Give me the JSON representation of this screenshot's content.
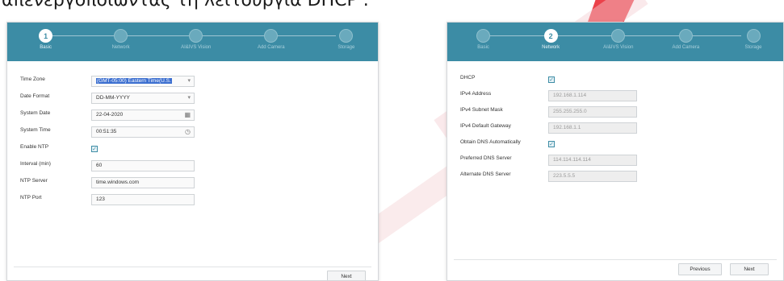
{
  "caption": "απενεργοποιώντας τη λειτουργία DHCP .",
  "steps": [
    "Basic",
    "Network",
    "AI&IVS Vision",
    "Add Camera",
    "Storage"
  ],
  "basic": {
    "current_step": "1",
    "rows": {
      "time_zone": {
        "label": "Time Zone",
        "value": "(GMT-05:00) Eastern Time(U.S. "
      },
      "date_format": {
        "label": "Date Format",
        "value": "DD-MM-YYYY"
      },
      "system_date": {
        "label": "System Date",
        "value": "22-04-2020"
      },
      "system_time": {
        "label": "System Time",
        "value": "00:51:35"
      },
      "enable_ntp": {
        "label": "Enable NTP",
        "checked": true
      },
      "interval": {
        "label": "Interval (min)",
        "value": "60"
      },
      "ntp_server": {
        "label": "NTP Server",
        "value": "time.windows.com"
      },
      "ntp_port": {
        "label": "NTP Port",
        "value": "123"
      }
    },
    "next_label": "Next"
  },
  "network": {
    "current_step": "2",
    "rows": {
      "dhcp": {
        "label": "DHCP",
        "checked": true
      },
      "ipv4_address": {
        "label": "IPv4 Address",
        "value": "192.168.1.114"
      },
      "ipv4_subnet": {
        "label": "IPv4 Subnet Mask",
        "value": "255.255.255.0"
      },
      "ipv4_gateway": {
        "label": "IPv4 Default Gateway",
        "value": "192.168.1.1"
      },
      "obtain_dns": {
        "label": "Obtain DNS Automatically",
        "checked": true
      },
      "preferred_dns": {
        "label": "Preferred DNS Server",
        "value": "114.114.114.114"
      },
      "alternate_dns": {
        "label": "Alternate DNS Server",
        "value": "223.5.5.5"
      }
    },
    "previous_label": "Previous",
    "next_label": "Next"
  },
  "colors": {
    "header": "#3c8ca5",
    "accent": "#3c6fd0",
    "watermark": "#e8202a"
  },
  "icons": {
    "calendar": "calendar-icon",
    "clock": "clock-icon",
    "dropdown": "chevron-down-icon",
    "check": "checkmark-icon"
  }
}
